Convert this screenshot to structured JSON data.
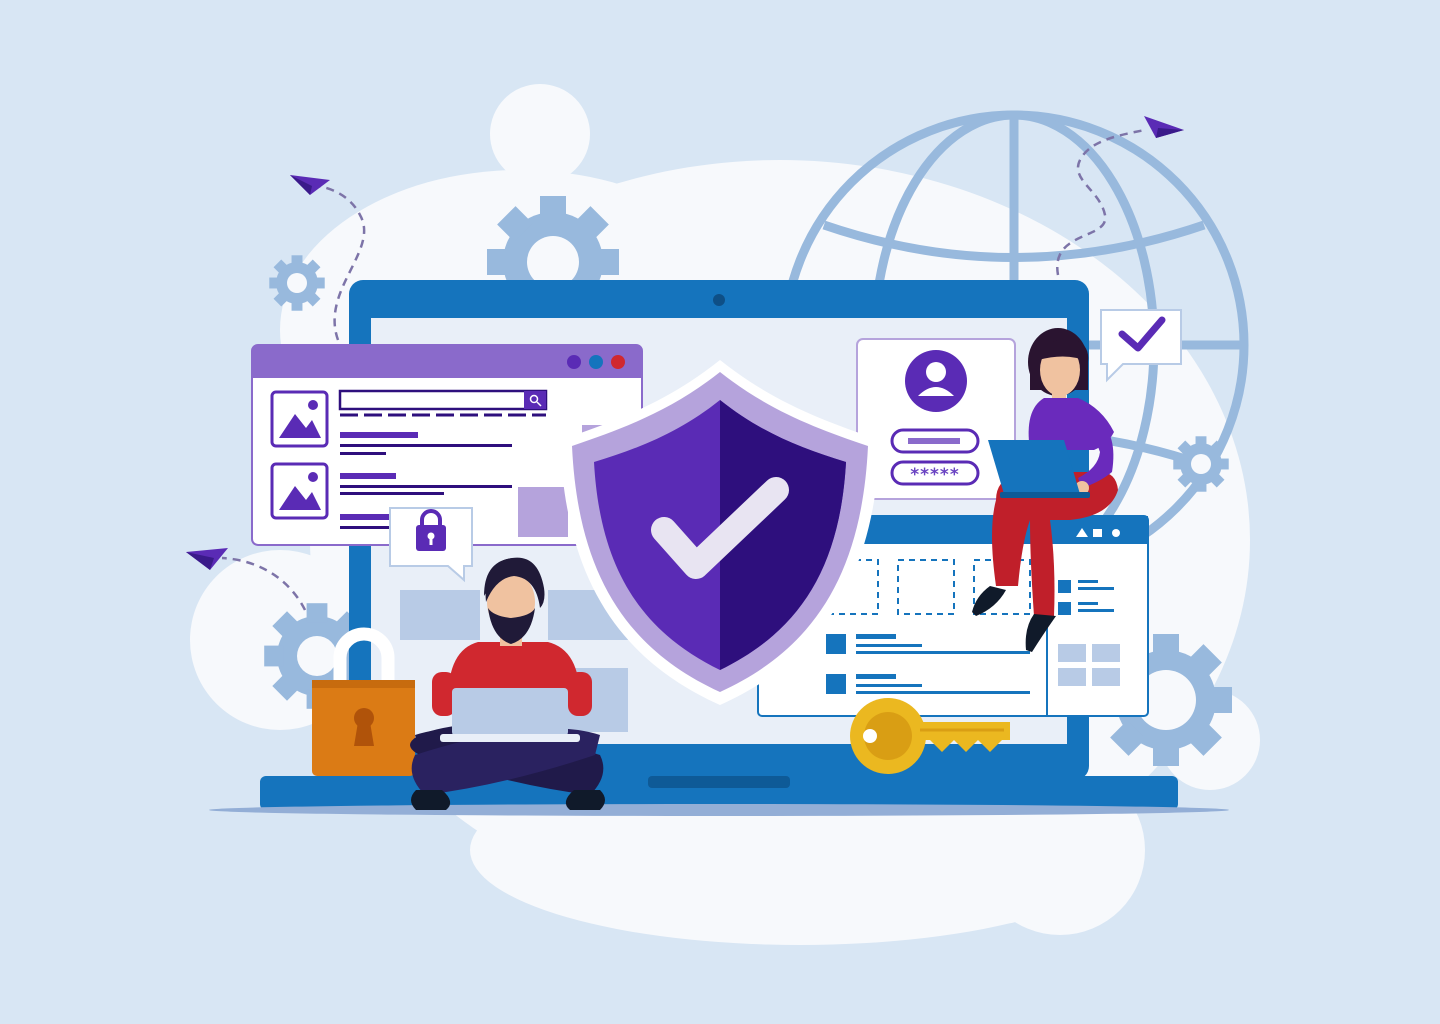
{
  "colors": {
    "background": "#d8e6f4",
    "cloud": "#f7f9fc",
    "laptop_frame": "#1574bd",
    "laptop_screen": "#e9eff8",
    "accent_purple": "#5a2bb5",
    "window_header_purple": "#8a6acb",
    "shield_dark": "#2e0f7d",
    "globe_gear": "#98b9dd",
    "padlock_orange": "#db7b15",
    "key_yellow": "#ebb820",
    "man_shirt": "#d0282f",
    "woman_pants": "#c01f2a"
  },
  "login_card": {
    "password_mask": "*****"
  },
  "icons": [
    "shield-check-icon",
    "user-avatar-icon",
    "padlock-icon",
    "key-icon",
    "globe-icon",
    "gear-icon",
    "paper-plane-icon",
    "image-placeholder-icon",
    "search-icon",
    "checkmark-bubble-icon",
    "lock-bubble-icon"
  ]
}
